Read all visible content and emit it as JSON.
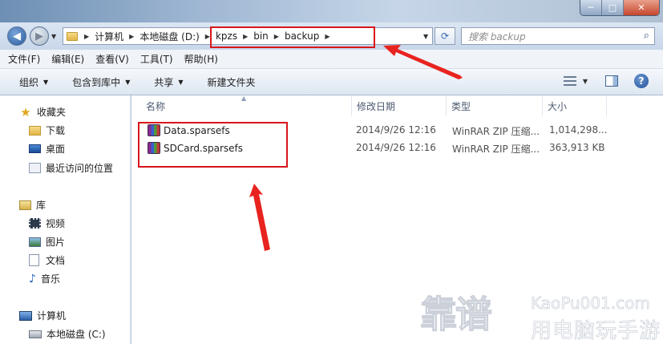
{
  "window": {
    "controls": {
      "minimize": "─",
      "maximize": "□",
      "close": "✕"
    }
  },
  "address": {
    "crumbs": [
      "计算机",
      "本地磁盘 (D:)",
      "kpzs",
      "bin",
      "backup"
    ],
    "search_placeholder": "搜索 backup"
  },
  "menu": [
    "文件(F)",
    "编辑(E)",
    "查看(V)",
    "工具(T)",
    "帮助(H)"
  ],
  "toolbar": {
    "organize": "组织",
    "include_in_library": "包含到库中",
    "share": "共享",
    "new_folder": "新建文件夹"
  },
  "nav": {
    "favorites": {
      "label": "收藏夹",
      "items": [
        "下载",
        "桌面",
        "最近访问的位置"
      ]
    },
    "libraries": {
      "label": "库",
      "items": [
        "视频",
        "图片",
        "文档",
        "音乐"
      ]
    },
    "computer": {
      "label": "计算机",
      "items": [
        "本地磁盘 (C:)"
      ]
    }
  },
  "columns": [
    "名称",
    "修改日期",
    "类型",
    "大小"
  ],
  "files": [
    {
      "name": "Data.sparsefs",
      "date": "2014/9/26 12:16",
      "type": "WinRAR ZIP 压缩...",
      "size": "1,014,298..."
    },
    {
      "name": "SDCard.sparsefs",
      "date": "2014/9/26 12:16",
      "type": "WinRAR ZIP 压缩...",
      "size": "363,913 KB"
    }
  ],
  "watermark": {
    "brand": "靠谱",
    "url": "KaoPu001.com",
    "slogan": "用电脑玩手游"
  },
  "colors": {
    "highlight": "#d8161b",
    "accent": "#2a5c9e"
  }
}
